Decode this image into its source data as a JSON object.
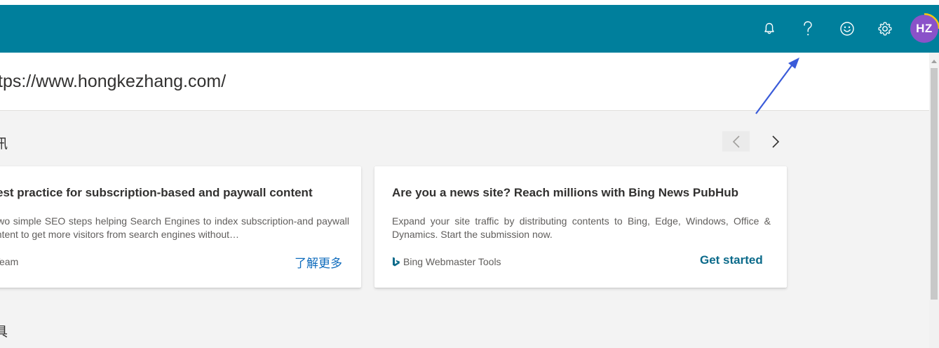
{
  "header": {
    "color": "#007f9c",
    "icons": [
      "bell-icon",
      "help-icon",
      "feedback-smiley-icon",
      "settings-gear-icon"
    ],
    "avatar_initials": "HZ",
    "avatar_color": "#8a52c9"
  },
  "url": {
    "text": "tps://www.hongkezhang.com/"
  },
  "sections": {
    "first_title": "讯",
    "second_title": "具"
  },
  "carousel": {
    "prev_icon": "chevron-left-icon",
    "next_icon": "chevron-right-icon",
    "cards": [
      {
        "title": "est practice for subscription-based and paywall content",
        "description": "g two simple SEO steps helping Search Engines to index subscription-and paywall content to get more visitors from search engines without…",
        "source": "Team",
        "cta": "了解更多"
      },
      {
        "title": "Are you a news site? Reach millions with Bing News PubHub",
        "description": "Expand your site traffic by distributing contents to Bing, Edge, Windows, Office & Dynamics. Start the submission now.",
        "source": "Bing Webmaster Tools",
        "source_icon": "bing-logo-icon",
        "cta": "Get started"
      }
    ]
  },
  "annotation": {
    "arrow_color": "#3a5bd9",
    "arrow_icon": "annotation-arrow-icon"
  }
}
